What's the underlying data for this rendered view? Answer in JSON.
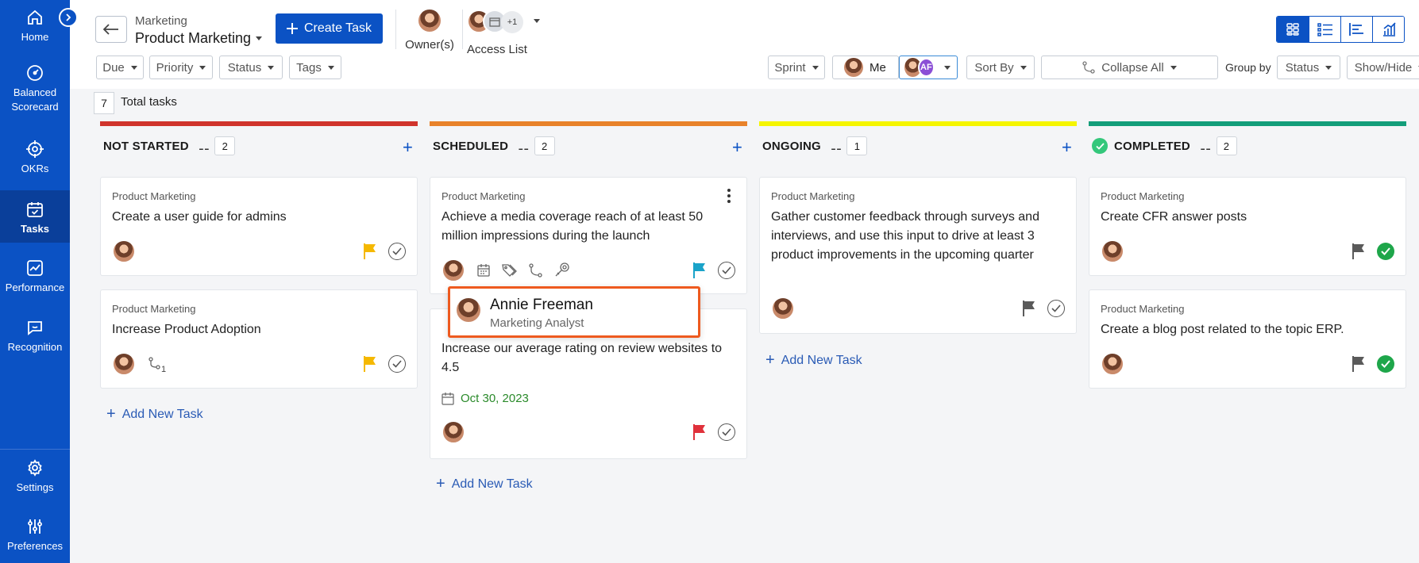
{
  "sidebar": {
    "items": [
      {
        "label": "Home",
        "icon": "home-icon"
      },
      {
        "label": "Balanced Scorecard",
        "icon": "gauge-icon"
      },
      {
        "label": "OKRs",
        "icon": "target-icon"
      },
      {
        "label": "Tasks",
        "icon": "calendar-check-icon",
        "active": true
      },
      {
        "label": "Performance",
        "icon": "chart-line-icon"
      },
      {
        "label": "Recognition",
        "icon": "chat-icon"
      },
      {
        "label": "Settings",
        "icon": "gear-icon"
      },
      {
        "label": "Preferences",
        "icon": "sliders-icon"
      }
    ]
  },
  "header": {
    "breadcrumb": "Marketing",
    "title": "Product Marketing",
    "create_label": "Create Task",
    "owners_label": "Owner(s)",
    "access_label": "Access List",
    "access_more": "+1"
  },
  "filters": {
    "due": "Due",
    "priority": "Priority",
    "status": "Status",
    "tags": "Tags",
    "sprint": "Sprint",
    "me": "Me",
    "af": "AF",
    "sort_by": "Sort By",
    "collapse_all": "Collapse All",
    "group_by_label": "Group by",
    "group_by_value": "Status",
    "show_hide": "Show/Hide"
  },
  "board": {
    "total_count": "7",
    "total_label": "Total tasks",
    "columns": [
      {
        "title": "NOT STARTED",
        "count": "2",
        "color": "#d0342c"
      },
      {
        "title": "SCHEDULED",
        "count": "2",
        "color": "#e8822a"
      },
      {
        "title": "ONGOING",
        "count": "1",
        "color": "#f5f500"
      },
      {
        "title": "COMPLETED",
        "count": "2",
        "color": "#139e7a"
      }
    ],
    "add_task_label": "Add New Task",
    "cards": {
      "ns1": {
        "project": "Product Marketing",
        "title": "Create a user guide for admins"
      },
      "ns2": {
        "project": "Product Marketing",
        "title": "Increase Product Adoption",
        "subtasks": "1"
      },
      "sc1": {
        "project": "Product Marketing",
        "title": "Achieve a media coverage reach of at least 50 million impressions during the launch"
      },
      "sc2": {
        "title": "Increase our average rating on review websites to 4.5",
        "due": "Oct 30, 2023"
      },
      "on1": {
        "project": "Product Marketing",
        "title": "Gather customer feedback through surveys and interviews, and use this input to drive at least 3 product improvements in the upcoming quarter"
      },
      "co1": {
        "project": "Product Marketing",
        "title": "Create CFR answer posts"
      },
      "co2": {
        "project": "Product Marketing",
        "title": "Create a blog post related to the topic ERP."
      }
    }
  },
  "popup": {
    "name": "Annie Freeman",
    "role": "Marketing Analyst"
  },
  "colors": {
    "brand": "#0b52c4",
    "flag_yellow": "#f5b800",
    "flag_teal": "#1aa3c9",
    "flag_red": "#e0313b",
    "flag_gray": "#5a5a5a",
    "popup_border": "#ee5a1f"
  }
}
